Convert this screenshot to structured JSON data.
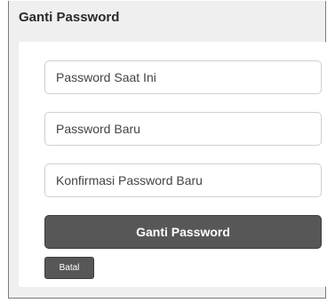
{
  "dialog": {
    "title": "Ganti Password"
  },
  "form": {
    "current_password": {
      "placeholder": "Password Saat Ini",
      "value": ""
    },
    "new_password": {
      "placeholder": "Password Baru",
      "value": ""
    },
    "confirm_password": {
      "placeholder": "Konfirmasi Password Baru",
      "value": ""
    },
    "submit_label": "Ganti Password",
    "cancel_label": "Batal"
  },
  "colors": {
    "button_background": "#575757",
    "button_text": "#ffffff",
    "window_background": "#efefef",
    "panel_background": "#ffffff"
  }
}
